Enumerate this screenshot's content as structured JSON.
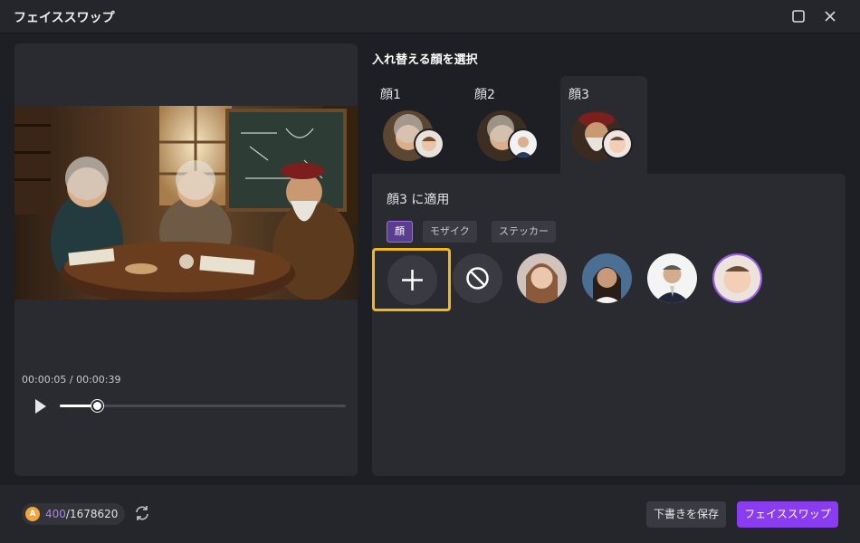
{
  "window": {
    "title": "フェイススワップ"
  },
  "player": {
    "time": "00:00:05 / 00:00:39",
    "progress": 0.13
  },
  "face_selector": {
    "heading": "入れ替える顔を選択",
    "tabs": [
      {
        "label": "顔1",
        "active": false
      },
      {
        "label": "顔2",
        "active": false
      },
      {
        "label": "顔3",
        "active": true
      }
    ]
  },
  "apply": {
    "label": "顔3 に適用",
    "modes": [
      {
        "label": "顔",
        "active": true
      },
      {
        "label": "モザイク",
        "active": false
      },
      {
        "label": "ステッカー",
        "active": false
      }
    ]
  },
  "footer": {
    "credits_used": "400",
    "credits_total": "/1678620",
    "save_draft": "下書きを保存",
    "face_swap": "フェイススワップ"
  },
  "colors": {
    "accent": "#8a3cf0",
    "highlight": "#f4b71a",
    "panel": "#2a2b31",
    "background": "#1e1f24"
  },
  "icons": [
    "maximize-icon",
    "close-icon",
    "play-icon",
    "plus-icon",
    "ban-icon",
    "refresh-icon",
    "coin-icon"
  ]
}
